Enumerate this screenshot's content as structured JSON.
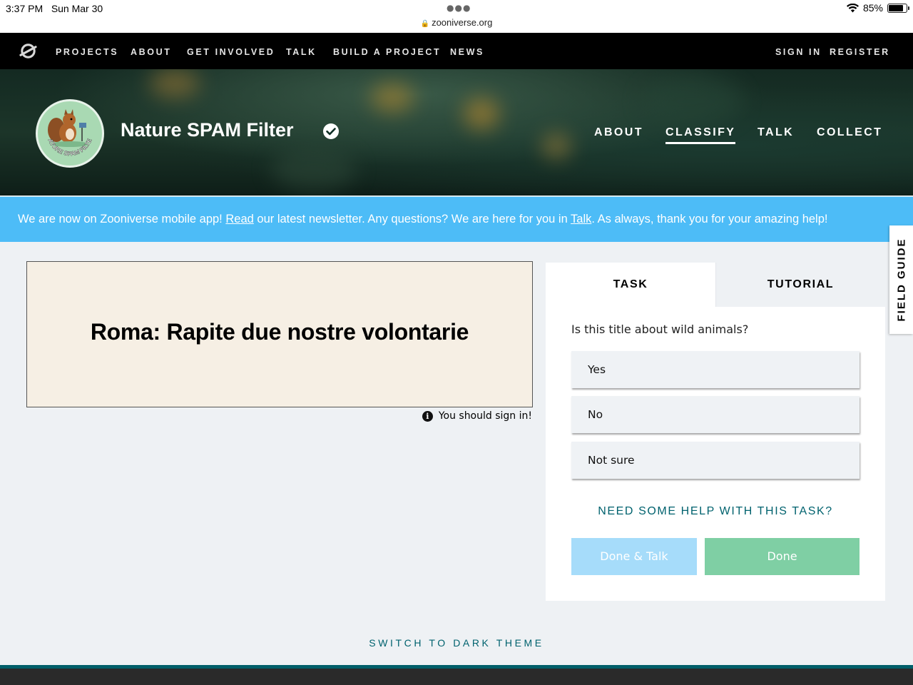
{
  "status_bar": {
    "time": "3:37 PM",
    "date": "Sun Mar 30",
    "url": "zooniverse.org",
    "battery": "85%",
    "battery_level": 0.85
  },
  "top_nav": {
    "links": [
      "PROJECTS",
      "ABOUT",
      "GET INVOLVED",
      "TALK",
      "BUILD A PROJECT",
      "NEWS"
    ],
    "sign_in": "SIGN IN",
    "register": "REGISTER"
  },
  "project": {
    "title": "Nature SPAM Filter",
    "avatar_text": "NATURE SPAM FILTER",
    "nav": [
      "ABOUT",
      "CLASSIFY",
      "TALK",
      "COLLECT"
    ],
    "active_nav": "CLASSIFY"
  },
  "announcement": {
    "part1": "We are now on Zooniverse mobile app! ",
    "link1": "Read",
    "part2": " our latest newsletter. Any questions? We are here for you in ",
    "link2": "Talk",
    "part3": ". As always, thank you for your amazing help!"
  },
  "subject": {
    "title": "Roma: Rapite due nostre volontarie",
    "sign_in_note": "You should sign in!"
  },
  "task": {
    "tabs": [
      "TASK",
      "TUTORIAL"
    ],
    "question": "Is this title about wild animals?",
    "answers": [
      "Yes",
      "No",
      "Not sure"
    ],
    "help": "NEED SOME HELP WITH THIS TASK?",
    "done_talk": "Done & Talk",
    "done": "Done"
  },
  "field_guide": "FIELD GUIDE",
  "dark_theme": "SWITCH TO DARK THEME",
  "colors": {
    "announcement_bg": "#4dbcf7",
    "accent_teal": "#00626e",
    "done_button": "#7fcfa4",
    "done_talk_button": "#a6dcfa"
  }
}
